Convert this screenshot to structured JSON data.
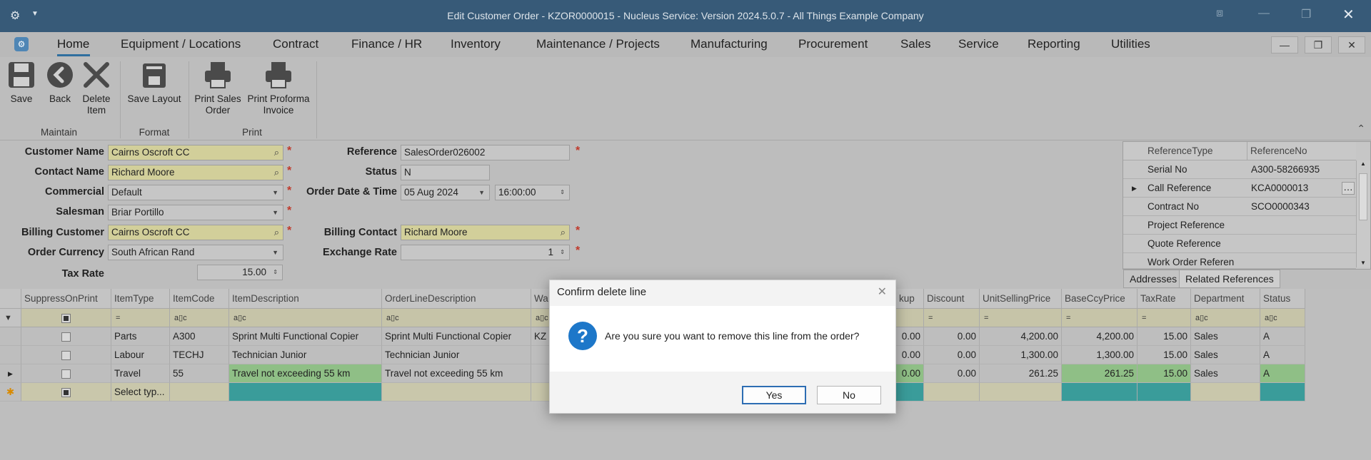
{
  "window": {
    "title": "Edit Customer Order - KZOR0000015 - Nucleus Service: Version 2024.5.0.7 - All Things Example Company"
  },
  "menu": {
    "items": [
      "Home",
      "Equipment / Locations",
      "Contract",
      "Finance / HR",
      "Inventory",
      "Maintenance / Projects",
      "Manufacturing",
      "Procurement",
      "Sales",
      "Service",
      "Reporting",
      "Utilities"
    ],
    "active": "Home"
  },
  "ribbon": {
    "buttons": {
      "save": "Save",
      "back": "Back",
      "delete_item": "Delete Item",
      "save_layout": "Save Layout",
      "print_sales_order": "Print Sales Order",
      "print_proforma_invoice": "Print Proforma Invoice"
    },
    "groups": {
      "maintain": "Maintain",
      "format": "Format",
      "print": "Print"
    }
  },
  "form": {
    "labels": {
      "customer_name": "Customer Name",
      "contact_name": "Contact Name",
      "commercial": "Commercial",
      "salesman": "Salesman",
      "billing_customer": "Billing Customer",
      "order_currency": "Order Currency",
      "tax_rate": "Tax Rate",
      "reference": "Reference",
      "status": "Status",
      "order_date_time": "Order Date & Time",
      "billing_contact": "Billing Contact",
      "exchange_rate": "Exchange Rate"
    },
    "values": {
      "customer_name": "Cairns Oscroft CC",
      "contact_name": "Richard Moore",
      "commercial": "Default",
      "salesman": "Briar Portillo",
      "billing_customer": "Cairns Oscroft CC",
      "order_currency": "South African Rand",
      "tax_rate": "15.00",
      "reference": "SalesOrder026002",
      "status": "N",
      "order_date": "05 Aug 2024",
      "order_time": "16:00:00",
      "billing_contact": "Richard Moore",
      "exchange_rate": "1"
    },
    "required_mark": "*"
  },
  "references": {
    "headers": [
      "ReferenceType",
      "ReferenceNo"
    ],
    "rows": [
      {
        "type": "Serial No",
        "no": "A300-58266935"
      },
      {
        "type": "Call Reference",
        "no": "KCA0000013"
      },
      {
        "type": "Contract No",
        "no": "SCO0000343"
      },
      {
        "type": "Project Reference",
        "no": ""
      },
      {
        "type": "Quote Reference",
        "no": ""
      },
      {
        "type": "Work Order Referen",
        "no": ""
      }
    ],
    "tabs": [
      "Addresses",
      "Related References"
    ],
    "active_tab": "Related References"
  },
  "grid": {
    "columns": [
      "SuppressOnPrint",
      "ItemType",
      "ItemCode",
      "ItemDescription",
      "OrderLineDescription",
      "Wa",
      "kup",
      "Discount",
      "UnitSellingPrice",
      "BaseCcyPrice",
      "TaxRate",
      "Department",
      "Status"
    ],
    "filter_eq": "=",
    "filter_text": "a▯c",
    "rows": [
      {
        "type": "Parts",
        "code": "A300",
        "desc": "Sprint Multi Functional Copier",
        "line_desc": "Sprint Multi Functional Copier",
        "wa": "KZ",
        "markup": "0.00",
        "discount": "0.00",
        "unit_price": "4,200.00",
        "base_price": "4,200.00",
        "tax": "15.00",
        "dept": "Sales",
        "status": "A"
      },
      {
        "type": "Labour",
        "code": "TECHJ",
        "desc": "Technician Junior",
        "line_desc": "Technician Junior",
        "wa": "",
        "markup": "0.00",
        "discount": "0.00",
        "unit_price": "1,300.00",
        "base_price": "1,300.00",
        "tax": "15.00",
        "dept": "Sales",
        "status": "A"
      },
      {
        "type": "Travel",
        "code": "55",
        "desc": "Travel not exceeding 55 km",
        "line_desc": "Travel not exceeding 55 km",
        "wa": "",
        "markup": "0.00",
        "discount": "0.00",
        "unit_price": "261.25",
        "base_price": "261.25",
        "tax": "15.00",
        "dept": "Sales",
        "status": "A"
      }
    ],
    "new_row_placeholder": "Select typ..."
  },
  "dialog": {
    "title": "Confirm delete line",
    "message": "Are you sure you want to remove this line from the order?",
    "yes": "Yes",
    "no": "No",
    "icon": "?"
  }
}
